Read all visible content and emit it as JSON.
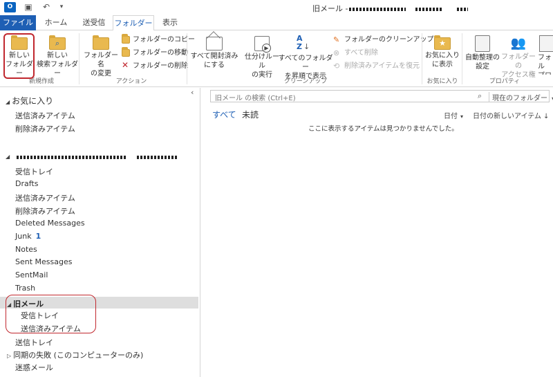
{
  "window": {
    "title": "旧メール -"
  },
  "tabs": [
    {
      "label": "ファイル"
    },
    {
      "label": "ホーム"
    },
    {
      "label": "送受信"
    },
    {
      "label": "フォルダー"
    },
    {
      "label": "表示"
    }
  ],
  "ribbon": {
    "new_group": {
      "label": "新規作成",
      "new_folder": "新しい\nフォルダー",
      "new_search_folder": "新しい\n検索フォルダー"
    },
    "action_group": {
      "label": "アクション",
      "rename_folder": "フォルダー名\nの変更",
      "copy_folder": "フォルダーのコピー",
      "move_folder": "フォルダーの移動",
      "delete_folder": "フォルダーの削除"
    },
    "cleanup_group": {
      "label": "クリーンアップ",
      "mark_all_read": "すべて開封済み\nにする",
      "run_rules": "仕分けルール\nの実行",
      "sort_folders": "すべてのフォルダー\nを昇順で表示",
      "folder_cleanup": "フォルダーのクリーンアップ",
      "delete_all": "すべて削除",
      "restore_deleted": "削除済みアイテムを復元"
    },
    "favorites_group": {
      "label": "お気に入り",
      "show_in_favorites": "お気に入り\nに表示"
    },
    "properties_group": {
      "label": "プロパティ",
      "autoarchive": "自動整理の\n設定",
      "folder_permissions": "フォルダーの\nアクセス権",
      "folder_properties": "フォル\nプロ"
    }
  },
  "nav": {
    "favorites_header": "お気に入り",
    "favorites": [
      "送信済みアイテム",
      "削除済みアイテム"
    ],
    "account_folders": [
      {
        "name": "受信トレイ"
      },
      {
        "name": "Drafts"
      },
      {
        "name": "送信済みアイテム"
      },
      {
        "name": "削除済みアイテム"
      },
      {
        "name": "Deleted Messages"
      },
      {
        "name": "Junk",
        "count": "1"
      },
      {
        "name": "Notes"
      },
      {
        "name": "Sent Messages"
      },
      {
        "name": "SentMail"
      },
      {
        "name": "Trash"
      }
    ],
    "selected_folder": "旧メール",
    "selected_children": [
      "受信トレイ",
      "送信済みアイテム"
    ],
    "after_folders": [
      "送信トレイ",
      "同期の失敗 (このコンピューターのみ)",
      "迷惑メール"
    ]
  },
  "content": {
    "search_placeholder": "旧メール の検索 (Ctrl+E)",
    "search_scope": "現在のフォルダー",
    "filter_all": "すべて",
    "filter_unread": "未読",
    "sort_by": "日付",
    "sort_order": "日付の新しいアイテム",
    "empty_message": "ここに表示するアイテムは見つかりませんでした。"
  },
  "colors": {
    "file_tab": "#1e5fb4",
    "accent": "#1e5fb4",
    "highlight": "#c0262d"
  }
}
